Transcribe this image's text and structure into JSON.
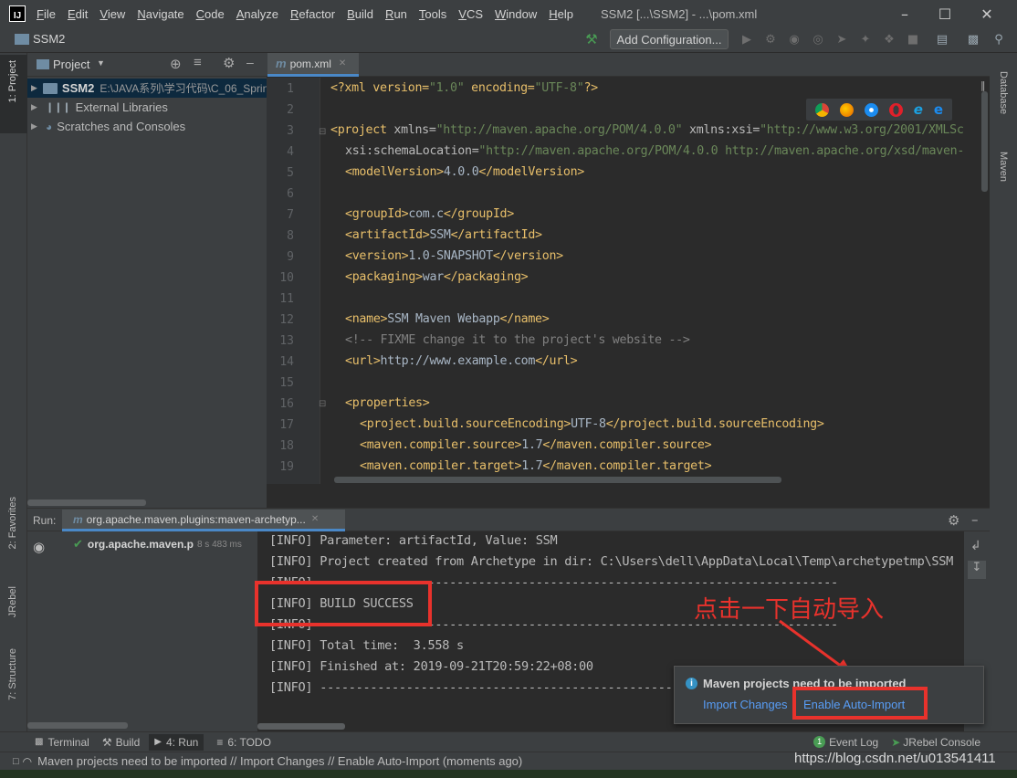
{
  "menubar": {
    "items": [
      "File",
      "Edit",
      "View",
      "Navigate",
      "Code",
      "Analyze",
      "Refactor",
      "Build",
      "Run",
      "Tools",
      "VCS",
      "Window",
      "Help"
    ],
    "window_title": "SSM2 [...\\SSM2] - ...\\pom.xml"
  },
  "navbar": {
    "project_name": "SSM2",
    "add_configuration": "Add Configuration..."
  },
  "left_strip": {
    "project": "1: Project",
    "favorites": "2: Favorites",
    "jrebel": "JRebel",
    "structure": "7: Structure"
  },
  "right_strip": {
    "database": "Database",
    "maven": "Maven"
  },
  "project_panel": {
    "title": "Project",
    "tree": [
      {
        "name": "SSM2",
        "path": "E:\\JAVA系列\\学习代码\\C_06_Sprin"
      },
      {
        "name": "External Libraries"
      },
      {
        "name": "Scratches and Consoles"
      }
    ]
  },
  "editor": {
    "tab": "pom.xml",
    "line_numbers": [
      "1",
      "2",
      "3",
      "4",
      "5",
      "6",
      "7",
      "8",
      "9",
      "10",
      "11",
      "12",
      "13",
      "14",
      "15",
      "16",
      "17",
      "18",
      "19"
    ]
  },
  "code": {
    "l1_a": "<?xml version=",
    "l1_b": "\"1.0\"",
    "l1_c": " encoding=",
    "l1_d": "\"UTF-8\"",
    "l1_e": "?>",
    "l3_a": "<project ",
    "l3_b": "xmlns=",
    "l3_c": "\"http://maven.apache.org/POM/4.0.0\"",
    "l3_d": " xmlns:xsi=",
    "l3_e": "\"http://www.w3.org/2001/XMLSc",
    "l4_a": "xsi:schemaLocation=",
    "l4_b": "\"http://maven.apache.org/POM/4.0.0 http://maven.apache.org/xsd/maven-",
    "l5_a": "<modelVersion>",
    "l5_b": "4.0.0",
    "l5_c": "</modelVersion>",
    "l7_a": "<groupId>",
    "l7_b": "com.c",
    "l7_c": "</groupId>",
    "l8_a": "<artifactId>",
    "l8_b": "SSM",
    "l8_c": "</artifactId>",
    "l9_a": "<version>",
    "l9_b": "1.0-SNAPSHOT",
    "l9_c": "</version>",
    "l10_a": "<packaging>",
    "l10_b": "war",
    "l10_c": "</packaging>",
    "l12_a": "<name>",
    "l12_b": "SSM Maven Webapp",
    "l12_c": "</name>",
    "l13": "<!-- FIXME change it to the project's website -->",
    "l14_a": "<url>",
    "l14_b": "http://www.example.com",
    "l14_c": "</url>",
    "l16": "<properties>",
    "l17_a": "<project.build.sourceEncoding>",
    "l17_b": "UTF-8",
    "l17_c": "</project.build.sourceEncoding>",
    "l18_a": "<maven.compiler.source>",
    "l18_b": "1.7",
    "l18_c": "</maven.compiler.source>",
    "l19_a": "<maven.compiler.target>",
    "l19_b": "1.7",
    "l19_c": "</maven.compiler.target>"
  },
  "run": {
    "label": "Run:",
    "tab": "org.apache.maven.plugins:maven-archetyp...",
    "tree_item": "org.apache.maven.p",
    "tree_time": "8 s 483 ms"
  },
  "console": {
    "lines": [
      "[INFO] Parameter: artifactId, Value: SSM",
      "[INFO] Project created from Archetype in dir: C:\\Users\\dell\\AppData\\Local\\Temp\\archetypetmp\\SSM",
      "[INFO] ------------------------------------------------------------------------",
      "[INFO] BUILD SUCCESS",
      "[INFO] ------------------------------------------------------------------------",
      "[INFO] Total time:  3.558 s",
      "[INFO] Finished at: 2019-09-21T20:59:22+08:00",
      "[INFO] ------------------------------------------------------------------------"
    ]
  },
  "annotation": "点击一下自动导入",
  "notification": {
    "title": "Maven projects need to be imported",
    "import_changes": "Import Changes",
    "enable_auto_import": "Enable Auto-Import"
  },
  "bottom_tabs": {
    "terminal": "Terminal",
    "build": "Build",
    "run": "4: Run",
    "todo": "6: TODO",
    "event_log": "Event Log",
    "jrebel_console": "JRebel Console",
    "event_count": "1"
  },
  "statusbar": {
    "message": "Maven projects need to be imported // Import Changes // Enable Auto-Import (moments ago)"
  },
  "watermark": "https://blog.csdn.net/u013541411",
  "colors": {
    "accent": "#4a88c7",
    "annotation_red": "#e8322c",
    "tag": "#e8bf6a",
    "string": "#6a8759",
    "run_green": "#499c54"
  }
}
